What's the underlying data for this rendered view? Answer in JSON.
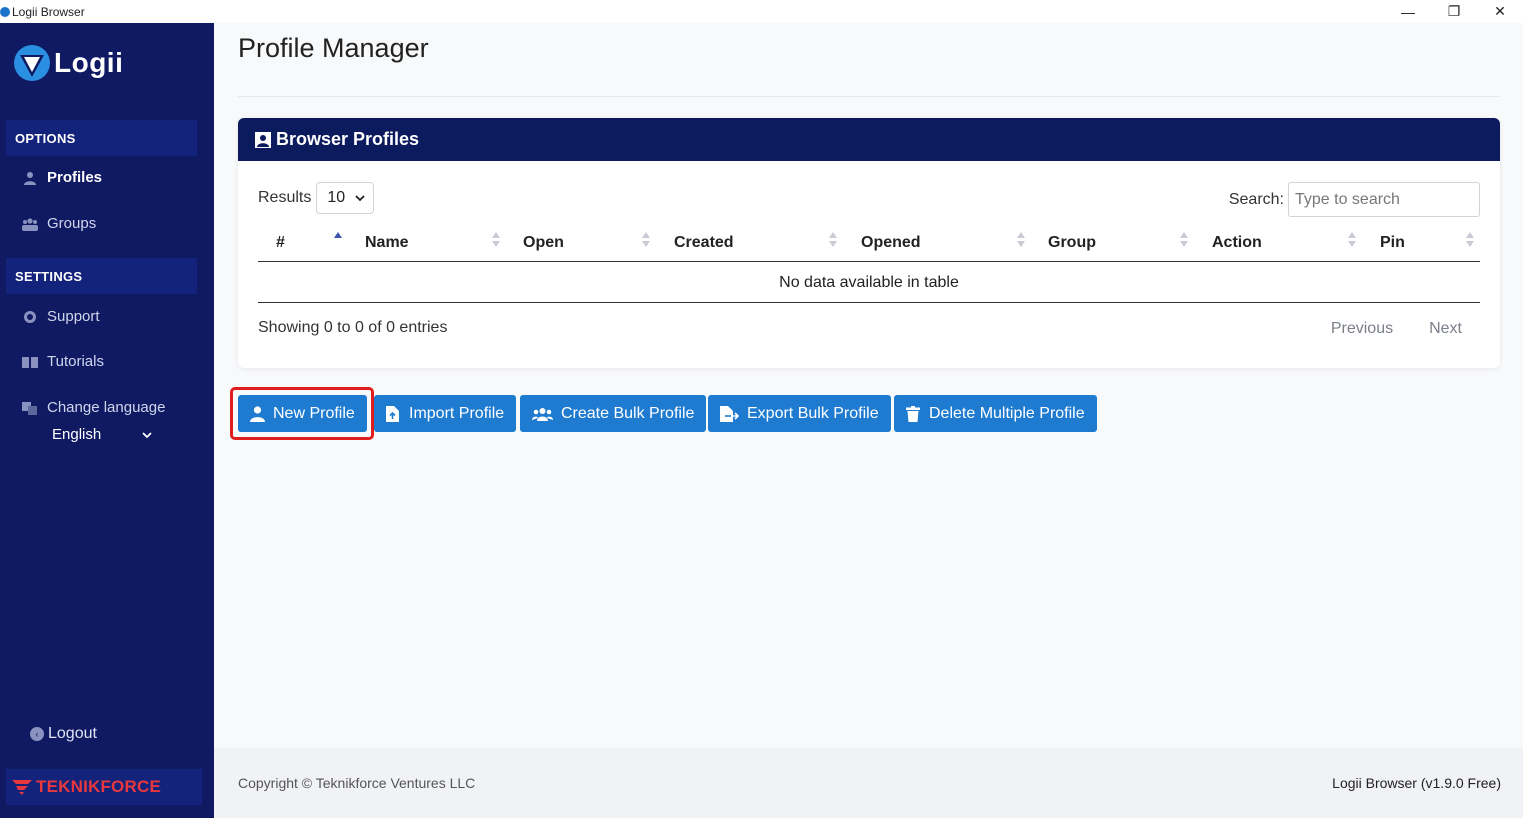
{
  "window": {
    "title": "Logii Browser",
    "minimize": "—",
    "maximize": "❐",
    "close": "✕"
  },
  "sidebar": {
    "logo_text": "Logii",
    "options_header": "OPTIONS",
    "settings_header": "SETTINGS",
    "items": [
      {
        "label": "Profiles",
        "icon": "user-icon",
        "active": true
      },
      {
        "label": "Groups",
        "icon": "users-icon",
        "active": false
      },
      {
        "label": "Support",
        "icon": "headset-icon",
        "active": false
      },
      {
        "label": "Tutorials",
        "icon": "book-icon",
        "active": false
      },
      {
        "label": "Change language",
        "icon": "language-icon",
        "active": false
      }
    ],
    "language": "English",
    "logout": "Logout",
    "brand": "TEKNIKFORCE"
  },
  "main": {
    "page_title": "Profile Manager",
    "card_title": "Browser Profiles",
    "results_label": "Results",
    "results_value": "10",
    "search_label": "Search:",
    "search_placeholder": "Type to search",
    "columns": [
      "#",
      "Name",
      "Open",
      "Created",
      "Opened",
      "Group",
      "Action",
      "Pin"
    ],
    "empty_message": "No data available in table",
    "info": "Showing 0 to 0 of 0 entries",
    "prev": "Previous",
    "next": "Next"
  },
  "actions": {
    "new_profile": "New Profile",
    "import_profile": "Import Profile",
    "create_bulk": "Create Bulk Profile",
    "export_bulk": "Export Bulk Profile",
    "delete_multiple": "Delete Multiple Profile"
  },
  "footer": {
    "copyright": "Copyright © Teknikforce Ventures LLC",
    "version": "Logii Browser (v1.9.0 Free)"
  },
  "colors": {
    "sidebar": "#0f1a63",
    "card_header": "#0c1a5e",
    "button": "#1f7bd0",
    "highlight": "#e01d1d"
  }
}
